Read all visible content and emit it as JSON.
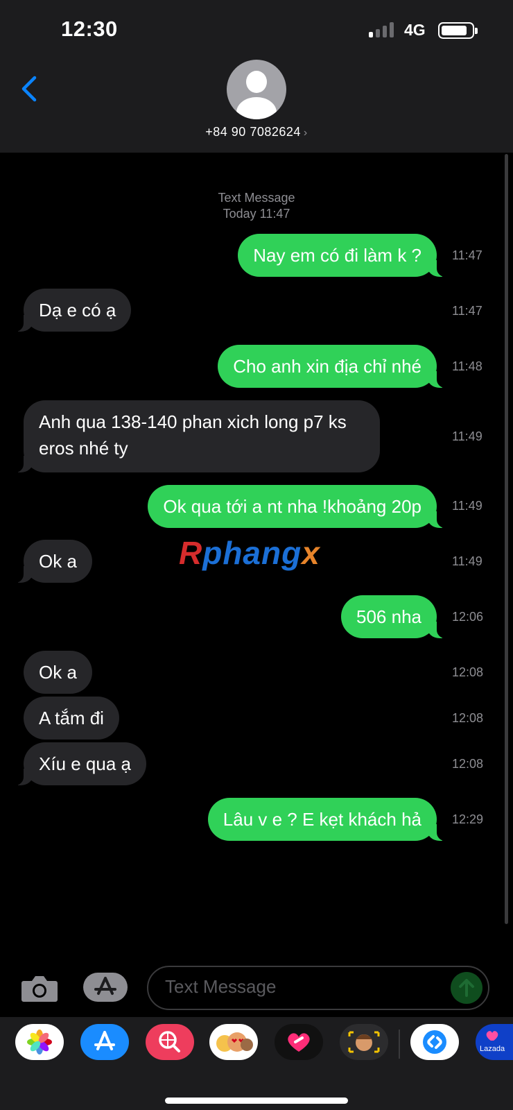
{
  "status_bar": {
    "time": "12:30",
    "network": "4G"
  },
  "header": {
    "contact": "+84 90 7082624",
    "chevron": "›"
  },
  "conversation": {
    "service": "Text Message",
    "date": "Today 11:47",
    "messages": [
      {
        "dir": "out",
        "text": "Nay em có đi làm k ?",
        "time": "11:47"
      },
      {
        "dir": "in",
        "text": "Dạ e có ạ",
        "time": "11:47"
      },
      {
        "dir": "out",
        "text": "Cho anh xin địa chỉ nhé",
        "time": "11:48"
      },
      {
        "dir": "in",
        "text": "Anh qua 138-140 phan xich long p7 ks eros nhé ty",
        "time": "11:49"
      },
      {
        "dir": "out",
        "text": "Ok qua tới a nt nha !khoảng 20p",
        "time": "11:49"
      },
      {
        "dir": "in",
        "text": "Ok a",
        "time": "11:49"
      },
      {
        "dir": "out",
        "text": "506 nha",
        "time": "12:06"
      },
      {
        "dir": "in",
        "text": "Ok a",
        "time": "12:08"
      },
      {
        "dir": "in",
        "text": "A tắm đi",
        "time": "12:08"
      },
      {
        "dir": "in",
        "text": "Xíu e qua ạ",
        "time": "12:08"
      },
      {
        "dir": "out",
        "text": "Lâu v e ? E kẹt khách hả",
        "time": "12:29"
      }
    ]
  },
  "watermark": {
    "part1": "R",
    "part2": "phang",
    "part3": "x"
  },
  "composer": {
    "placeholder": "Text Message"
  },
  "app_drawer": {
    "apps": [
      "photos-icon",
      "app-store-icon",
      "web-search-icon",
      "memoji-stickers-icon",
      "digital-touch-icon",
      "memoji-icon",
      "shazam-icon",
      "lazada-icon"
    ],
    "lazada_label": "Lazada"
  },
  "colors": {
    "outgoing_bubble": "#30d158",
    "incoming_bubble": "#262629",
    "accent": "#0a84ff"
  }
}
